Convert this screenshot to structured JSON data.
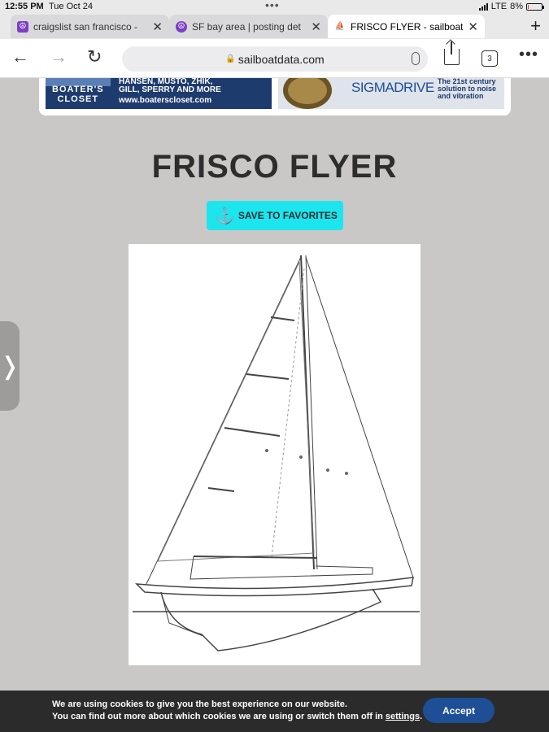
{
  "status_bar": {
    "time": "12:55 PM",
    "date": "Tue Oct 24",
    "network": "LTE",
    "battery": "8%",
    "battery_level": 0.08
  },
  "tabs": [
    {
      "label": "craigslist san francisco -",
      "icon": "craigslist-icon",
      "active": false
    },
    {
      "label": "SF bay area | posting det",
      "icon": "peace-icon",
      "active": false
    },
    {
      "label": "FRISCO FLYER - sailboat",
      "icon": "sailboat-icon",
      "active": true
    }
  ],
  "toolbar": {
    "url": "sailboatdata.com",
    "tab_count": "3"
  },
  "ads": {
    "left": {
      "brand_line1": "BOATER'S",
      "brand_line2": "CLOSET",
      "brands_line1": "HANSEN, MUSTO, ZHIK,",
      "brands_line2": "GILL, SPERRY AND MORE",
      "url": "www.boaterscloset.com"
    },
    "right": {
      "brand": "SIGMADRIVE",
      "tag1": "The 21st century",
      "tag2": "solution to noise",
      "tag3": "and vibration"
    }
  },
  "page": {
    "title": "FRISCO FLYER",
    "save_button": "SAVE TO FAVORITES"
  },
  "cookie": {
    "line1": "We are using cookies to give you the best experience on our website.",
    "line2": "You can find out more about which cookies we are using or switch them off in ",
    "link": "settings",
    "line2_end": ".",
    "accept": "Accept"
  }
}
